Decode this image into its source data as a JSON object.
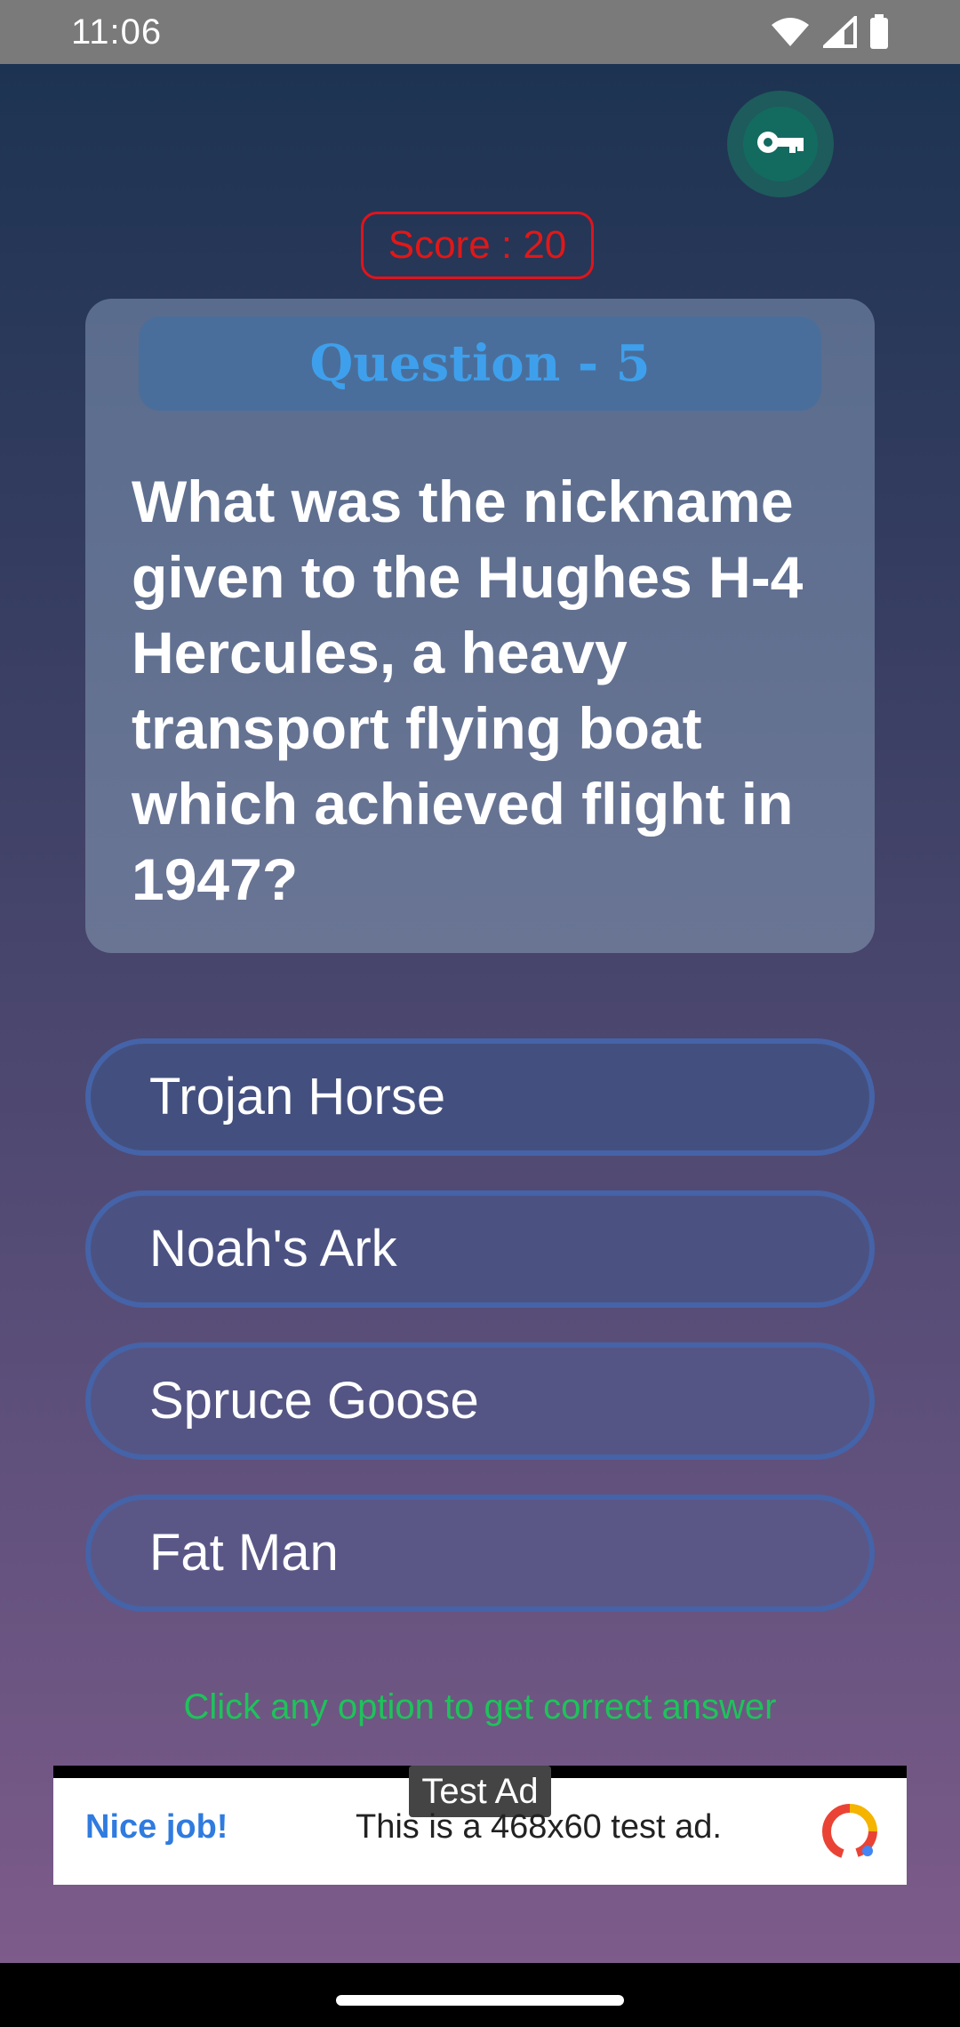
{
  "status_bar": {
    "time": "11:06",
    "icons": [
      "wifi-icon",
      "signal-icon",
      "battery-icon"
    ]
  },
  "app": {
    "key_button_icon": "key-icon",
    "score_text": "Score : 20",
    "question_title": "Question - 5",
    "question_text": "What was the nickname given to the Hughes H-4 Hercules, a heavy transport flying boat which achieved flight in 1947?",
    "options": [
      "Trojan Horse",
      "Noah's Ark",
      "Spruce Goose",
      "Fat Man"
    ],
    "hint": "Click any option to get correct answer"
  },
  "ad": {
    "label": "Test Ad",
    "headline": "Nice job!",
    "body": "This is a 468x60 test ad."
  },
  "colors": {
    "score": "#e01818",
    "question_title": "#3ea0ec",
    "hint": "#1ec35a",
    "option_border": "#4563a8"
  }
}
